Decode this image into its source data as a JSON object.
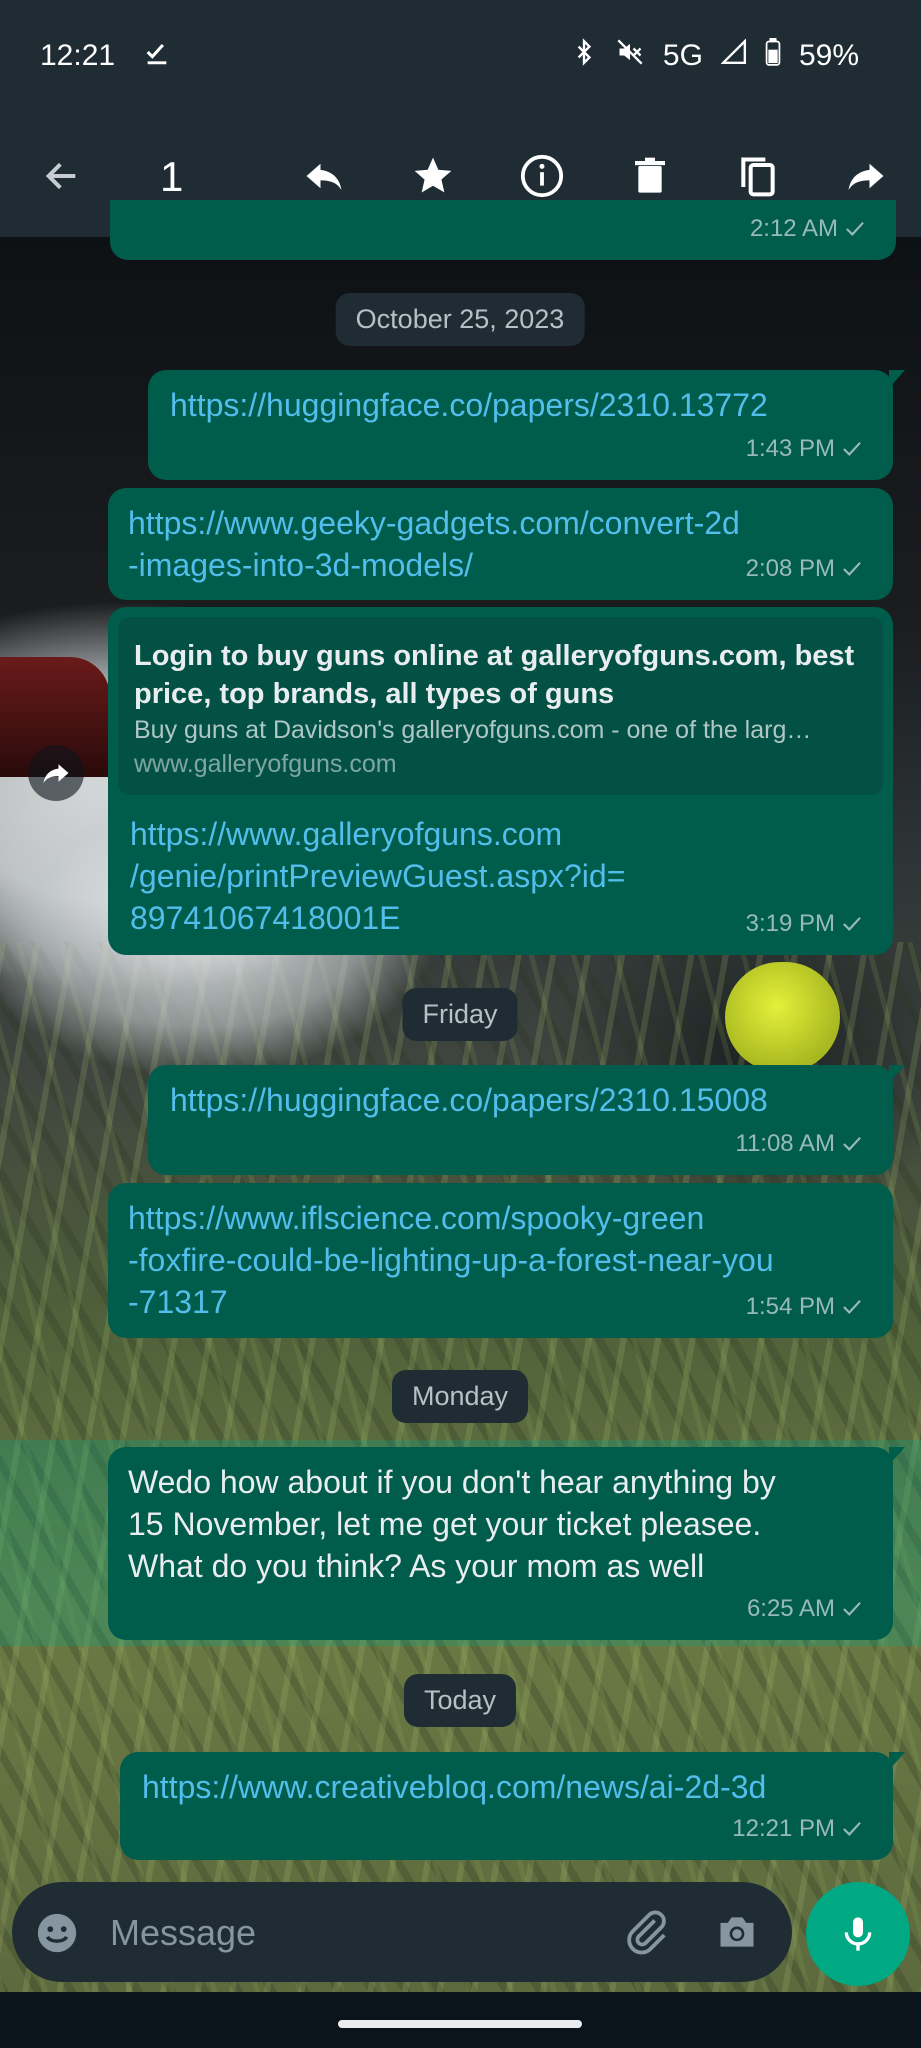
{
  "status_bar": {
    "time": "12:21",
    "network": "5G",
    "battery": "59%"
  },
  "action_bar": {
    "selected_count": "1"
  },
  "messages": [
    {
      "type": "date",
      "label": "October 25, 2023"
    },
    {
      "type": "link",
      "text": "https://huggingface.co/papers/2310.13772",
      "time": "1:43 PM"
    },
    {
      "type": "link",
      "text": "https://www.geeky-gadgets.com/convert-2d\n-images-into-3d-models/",
      "time": "2:08 PM"
    },
    {
      "type": "link-preview",
      "preview_title": "Login to buy guns online at galleryofguns.com, best price, top brands, all types of guns",
      "preview_desc": "Buy guns at Davidson's galleryofguns.com - one of the larg…",
      "preview_domain": "www.galleryofguns.com",
      "text": "https://www.galleryofguns.com\n/genie/printPreviewGuest.aspx?id=\n89741067418001E",
      "time": "3:19 PM"
    },
    {
      "type": "date",
      "label": "Friday"
    },
    {
      "type": "link",
      "text": "https://huggingface.co/papers/2310.15008",
      "time": "11:08 AM"
    },
    {
      "type": "link",
      "text": "https://www.iflscience.com/spooky-green\n-foxfire-could-be-lighting-up-a-forest-near-you\n-71317",
      "time": "1:54 PM"
    },
    {
      "type": "date",
      "label": "Monday"
    },
    {
      "type": "text",
      "text": "Wedo how about if you don't hear anything by\n15 November, let me get your ticket pleasee.\nWhat do you think? As your mom as well",
      "time": "6:25 AM"
    },
    {
      "type": "date",
      "label": "Today"
    },
    {
      "type": "link",
      "text": "https://www.creativebloq.com/news/ai-2d-3d",
      "time": "12:21 PM"
    }
  ],
  "partial_top_message_time": "2:12 AM",
  "composer": {
    "placeholder": "Message"
  },
  "colors": {
    "bubble_out": "#005c4b",
    "link": "#53bdeb",
    "accent": "#00a884",
    "bar": "#1f2c34"
  }
}
